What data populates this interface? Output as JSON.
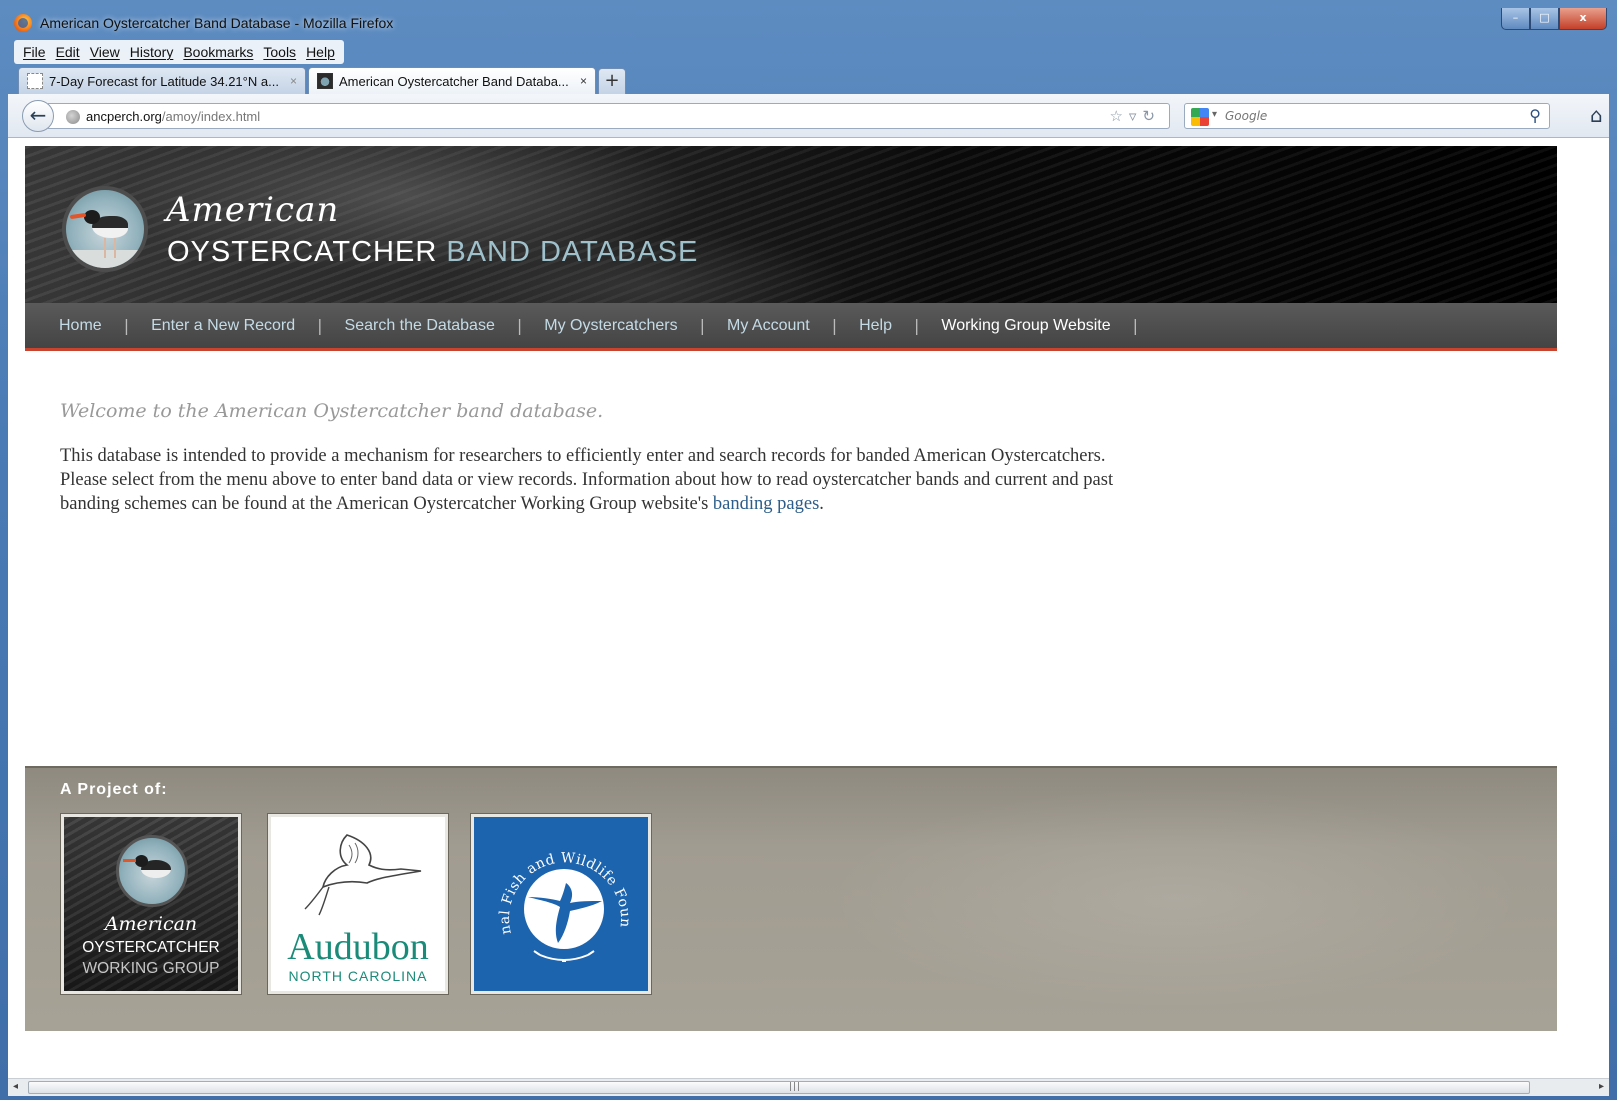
{
  "window": {
    "title": "American Oystercatcher Band Database - Mozilla Firefox",
    "buttons": {
      "minimize": "–",
      "maximize": "□",
      "close": "x"
    }
  },
  "menu": [
    "File",
    "Edit",
    "View",
    "History",
    "Bookmarks",
    "Tools",
    "Help"
  ],
  "tabs": [
    {
      "label": "7-Day Forecast for Latitude 34.21°N a...",
      "close": "×"
    },
    {
      "label": "American Oystercatcher Band Databa...",
      "close": "×"
    }
  ],
  "new_tab": "+",
  "address": {
    "host": "ancperch.org",
    "path": "/amoy/index.html"
  },
  "search": {
    "placeholder": "Google"
  },
  "site": {
    "brand_script": "American",
    "brand_primary": "OYSTERCATCHER",
    "brand_secondary": "BAND DATABASE"
  },
  "nav": [
    {
      "label": "Home"
    },
    {
      "label": "Enter a New Record"
    },
    {
      "label": "Search the Database"
    },
    {
      "label": "My Oystercatchers"
    },
    {
      "label": "My Account"
    },
    {
      "label": "Help"
    },
    {
      "label": "Working Group Website"
    }
  ],
  "nav_separator": "|",
  "content": {
    "welcome": "Welcome to the American Oystercatcher band database.",
    "intro": "This database is intended to provide a mechanism for researchers to efficiently enter and search records for banded American Oystercatchers. Please select from the menu above to enter band data or view records. Information about how to read oystercatcher bands and current and past banding schemes can be found at the American Oystercatcher Working Group website's ",
    "link_text": "banding pages",
    "intro_end": "."
  },
  "footer": {
    "heading": "A Project of:",
    "partners": [
      {
        "script": "American",
        "line1": "OYSTERCATCHER",
        "line2": "WORKING GROUP"
      },
      {
        "line1": "Audubon",
        "line2": "NORTH CAROLINA"
      },
      {
        "arc_text": "National Fish and Wildlife Foundation"
      }
    ]
  },
  "colors": {
    "nav_bar": "#4e4e4e",
    "nav_underline": "#c8442e",
    "link": "#2c5d8a",
    "audubon_teal": "#1b8b79",
    "nfwf_blue": "#1d64ae",
    "footer_bg": "#a19c91"
  }
}
